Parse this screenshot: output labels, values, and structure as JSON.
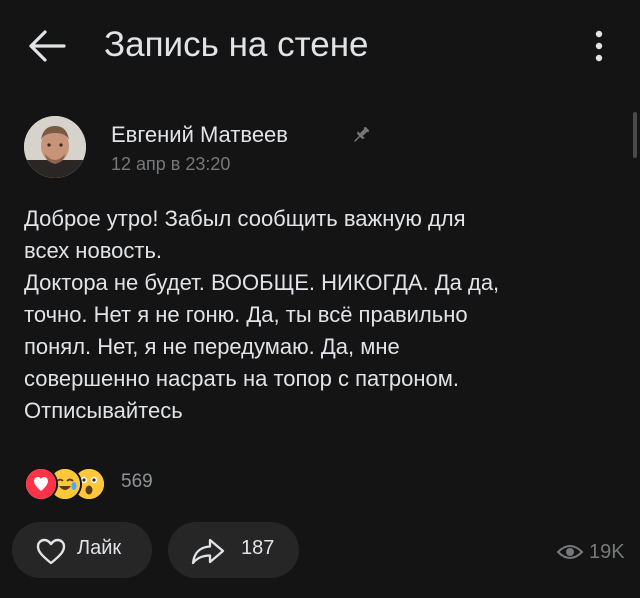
{
  "header": {
    "title": "Запись на стене"
  },
  "post": {
    "author": "Евгений Матвеев",
    "date": "12 апр в 23:20",
    "text_lines": [
      "Доброе утро! Забыл сообщить важную для",
      "всех новость.",
      "Доктора не будет. ВООБЩЕ. НИКОГДА. Да да,",
      "точно. Нет я не гоню. Да, ты всё правильно",
      "понял. Нет, я не передумаю. Да, мне",
      "совершенно насрать на топор с патроном.",
      "Отписывайтесь"
    ],
    "reactions": {
      "icons": [
        "heart-reaction",
        "crying-laughing-reaction",
        "shocked-reaction"
      ],
      "count": "569"
    }
  },
  "actions": {
    "like_label": "Лайк",
    "share_count": "187",
    "views": "19K"
  },
  "colors": {
    "background": "#141414",
    "text": "#e1e3e6",
    "secondary": "#76787a",
    "pill": "#262626",
    "heart": "#ff3347"
  }
}
